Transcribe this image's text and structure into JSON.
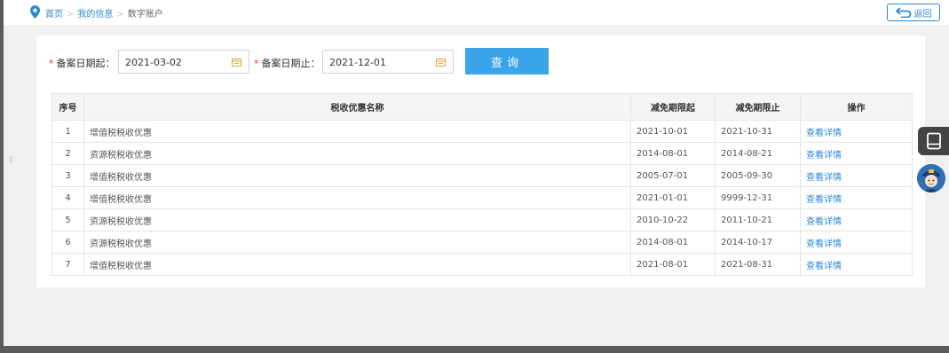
{
  "breadcrumb": {
    "home": "首页",
    "my_info": "我的信息",
    "current": "数字账户"
  },
  "back_button": "返回",
  "filter": {
    "start_label": "备案日期起：",
    "start_value": "2021-03-02",
    "end_label": "备案日期止：",
    "end_value": "2021-12-01",
    "required_mark": "*",
    "query_button": "查询"
  },
  "table": {
    "headers": {
      "index": "序号",
      "name": "税收优惠名称",
      "start": "减免期限起",
      "end": "减免期限止",
      "action": "操作"
    },
    "rows": [
      {
        "index": "1",
        "name": "增值税税收优惠",
        "start": "2021-10-01",
        "end": "2021-10-31",
        "action": "查看详情"
      },
      {
        "index": "2",
        "name": "资源税税收优惠",
        "start": "2014-08-01",
        "end": "2014-08-21",
        "action": "查看详情"
      },
      {
        "index": "3",
        "name": "增值税税收优惠",
        "start": "2005-07-01",
        "end": "2005-09-30",
        "action": "查看详情"
      },
      {
        "index": "4",
        "name": "增值税税收优惠",
        "start": "2021-01-01",
        "end": "9999-12-31",
        "action": "查看详情"
      },
      {
        "index": "5",
        "name": "资源税税收优惠",
        "start": "2010-10-22",
        "end": "2011-10-21",
        "action": "查看详情"
      },
      {
        "index": "6",
        "name": "资源税税收优惠",
        "start": "2014-08-01",
        "end": "2014-10-17",
        "action": "查看详情"
      },
      {
        "index": "7",
        "name": "增值税税收优惠",
        "start": "2021-08-01",
        "end": "2021-08-31",
        "action": "查看详情"
      }
    ]
  },
  "icons": {
    "location": "location-pin-icon",
    "back": "return-arrow-icon",
    "calendar": "calendar-icon",
    "book": "book-icon",
    "avatar": "assistant-avatar-icon"
  },
  "colors": {
    "accent": "#2b89d6",
    "button": "#39a4ea",
    "required": "#e23b2e"
  }
}
